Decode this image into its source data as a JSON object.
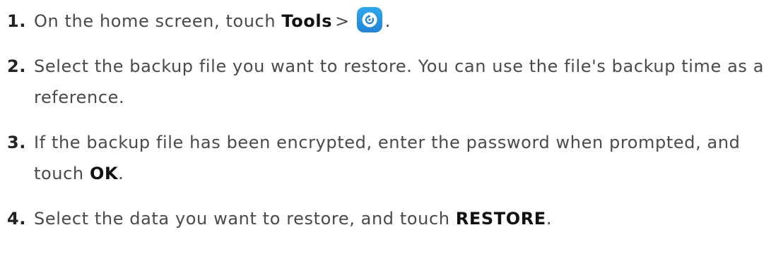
{
  "steps": [
    {
      "number": "1.",
      "text_before": "On the home screen, touch ",
      "bold": "Tools",
      "separator": ">",
      "icon": "backup-restore-icon",
      "text_after": "."
    },
    {
      "number": "2.",
      "text": "Select the backup file you want to restore. You can use the file's backup time as a reference."
    },
    {
      "number": "3.",
      "text_before": "If the backup file has been encrypted, enter the password when prompted, and touch ",
      "bold": "OK",
      "text_after": "."
    },
    {
      "number": "4.",
      "text_before": "Select the data you want to restore, and touch ",
      "bold": "RESTORE",
      "text_after": "."
    }
  ],
  "colors": {
    "text": "#4a4a4a",
    "bold_text": "#111111",
    "icon_background": "#1e83d6"
  }
}
